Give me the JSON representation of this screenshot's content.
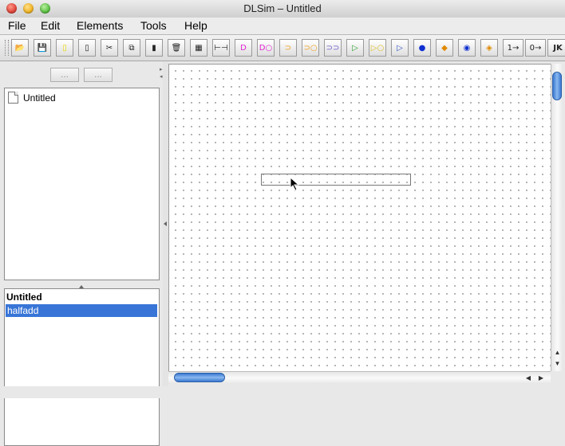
{
  "window": {
    "title": "DLSim – Untitled"
  },
  "menu": {
    "items": [
      "File",
      "Edit",
      "Elements",
      "Tools",
      "Help"
    ]
  },
  "toolbar": {
    "buttons": [
      {
        "icon": "open-folder-icon",
        "glyph": "📂"
      },
      {
        "icon": "save-icon",
        "glyph": "💾"
      },
      {
        "icon": "new-yellow-doc-icon",
        "glyph": "▯"
      },
      {
        "icon": "new-doc-icon",
        "glyph": "▯"
      },
      {
        "icon": "cut-icon",
        "glyph": "✂"
      },
      {
        "icon": "copy-icon",
        "glyph": "⧉"
      },
      {
        "icon": "paste-icon",
        "glyph": "▮"
      },
      {
        "icon": "delete-icon",
        "glyph": "🗑"
      },
      {
        "icon": "delete-all-icon",
        "glyph": "▦"
      },
      {
        "icon": "wire-icon",
        "glyph": "⊢⊣"
      },
      {
        "icon": "and-gate-icon",
        "glyph": "D"
      },
      {
        "icon": "nand-gate-icon",
        "glyph": "D○"
      },
      {
        "icon": "or-gate-icon",
        "glyph": "⊃"
      },
      {
        "icon": "nor-gate-icon",
        "glyph": "⊃○"
      },
      {
        "icon": "xor-gate-icon",
        "glyph": "⊃⊃"
      },
      {
        "icon": "buffer-icon",
        "glyph": "▷"
      },
      {
        "icon": "not-gate-icon",
        "glyph": "▷○"
      },
      {
        "icon": "tristate-icon",
        "glyph": "▷"
      },
      {
        "icon": "input-pin-icon",
        "glyph": "●"
      },
      {
        "icon": "output-pin-icon",
        "glyph": "◆"
      },
      {
        "icon": "led-icon",
        "glyph": "◉"
      },
      {
        "icon": "probe-icon",
        "glyph": "◈"
      },
      {
        "icon": "constant-one-icon",
        "glyph": "1→"
      },
      {
        "icon": "constant-zero-icon",
        "glyph": "0→"
      },
      {
        "icon": "jk-flipflop-icon",
        "glyph": "JK"
      }
    ]
  },
  "left_pane": {
    "split_buttons": [
      "...",
      "..."
    ],
    "tree": {
      "item": "Untitled"
    },
    "list": {
      "header": "Untitled",
      "selected": "halfadd"
    }
  },
  "colors": {
    "selection": "#3875d7",
    "scroll_thumb": "#3a78d0"
  }
}
